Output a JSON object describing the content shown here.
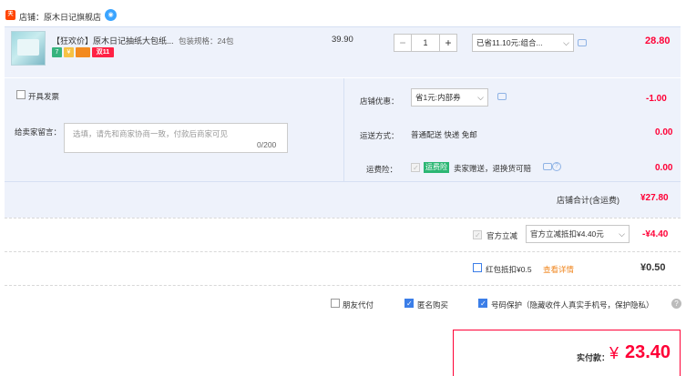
{
  "shop": {
    "icon_label": "天猫",
    "label": "店铺：原木日记旗舰店"
  },
  "item": {
    "title": "【狂欢价】原木日记抽纸大包纸...",
    "spec": "包装规格：24包",
    "tags": [
      "7",
      "¥",
      "",
      "双11"
    ],
    "price": "39.90",
    "quantity": "1",
    "minus": "−",
    "plus": "+",
    "promo_select": "已省11.10元:组合...",
    "total": "28.80"
  },
  "options": {
    "invoice_label": "开具发票",
    "message_label": "给卖家留言：",
    "message_placeholder": "选填，请先和商家协商一致，付款后商家可见",
    "message_count": "0/200",
    "shop_promo_label": "店铺优惠：",
    "shop_promo_select": "省1元:内部券",
    "shop_promo_value": "-1.00",
    "shipping_label": "运送方式：",
    "shipping_desc": "普通配送 快递 免邮",
    "shipping_value": "0.00",
    "insurance_label": "运费险：",
    "insurance_badge": "运费险",
    "insurance_desc": "卖家赠送，退换货可赔",
    "insurance_help": "?",
    "insurance_value": "0.00",
    "subtotal_label": "店铺合计(含运费)",
    "subtotal_value": "¥27.80"
  },
  "platform": {
    "discount_label": "官方立减",
    "discount_select": "官方立减抵扣¥4.40元",
    "discount_value": "-¥4.40",
    "redpacket_label": "红包抵扣¥0.5",
    "redpacket_link": "查看详情",
    "redpacket_value": "¥0.50"
  },
  "bottom": {
    "friend_pay": "朋友代付",
    "anonymous": "匿名购买",
    "phone_protect": "号码保护（隐藏收件人真实手机号，保护隐私）",
    "help": "?"
  },
  "pay": {
    "label": "实付款：",
    "currency": "¥",
    "value": "23.40"
  },
  "colors": {
    "accent": "#ff0036",
    "checkbox": "#3b7ee8",
    "panel": "#eef2fb"
  }
}
